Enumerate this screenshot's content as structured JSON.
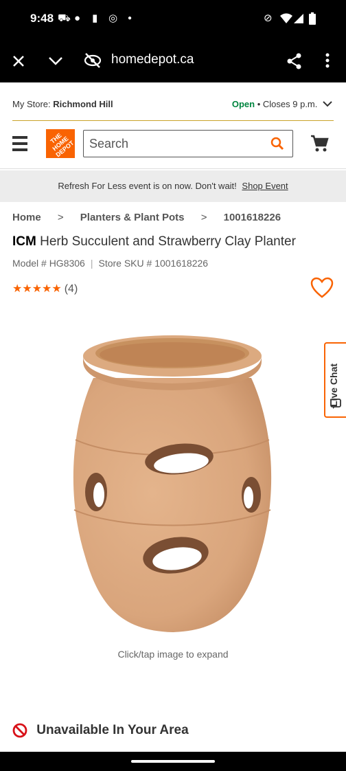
{
  "status_bar": {
    "time": "9:48",
    "left_icons": [
      "car-icon",
      "chat-bubble-icon",
      "clipboard-icon",
      "chrome-icon",
      "dot-icon"
    ],
    "right_icons": [
      "vibrate-off-icon",
      "wifi-icon",
      "signal-icon",
      "battery-icon"
    ]
  },
  "browser": {
    "url": "homedepot.ca"
  },
  "store": {
    "label": "My Store:",
    "name": "Richmond Hill",
    "open": "Open",
    "closes": "• Closes 9 p.m."
  },
  "header": {
    "logo_text": "THE HOME DEPOT",
    "search_placeholder": "Search"
  },
  "promo": {
    "text": "Refresh For Less event is on now. Don't wait!",
    "link": "Shop Event"
  },
  "breadcrumbs": [
    {
      "label": "Home"
    },
    {
      "label": "Planters & Plant Pots"
    },
    {
      "label": "1001618226"
    }
  ],
  "product": {
    "brand": "ICM",
    "title": "Herb Succulent and Strawberry Clay Planter",
    "model": "Model # HG8306",
    "sku": "Store SKU # 1001618226",
    "stars": "★★★★★",
    "rating_value": 4.6,
    "review_count": "(4)",
    "caption": "Click/tap image to expand",
    "availability": "Unavailable In Your Area"
  },
  "live_chat": {
    "label": "Live Chat"
  },
  "colors": {
    "brand_orange": "#f96302",
    "open_green": "#00853f",
    "terracotta": "#d9a57c"
  }
}
